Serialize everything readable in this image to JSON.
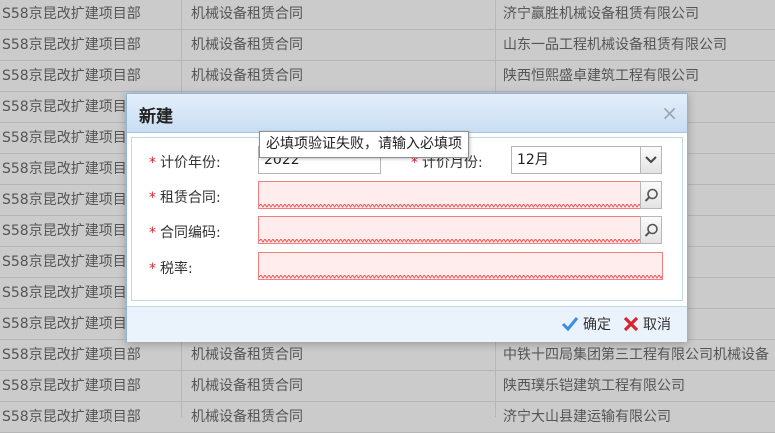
{
  "background_table": {
    "rows": [
      {
        "project": "S58京昆改扩建项目部",
        "type": "机械设备租赁合同",
        "company": "济宁赢胜机械设备租赁有限公司"
      },
      {
        "project": "S58京昆改扩建项目部",
        "type": "机械设备租赁合同",
        "company": "山东一品工程机械设备租赁有限公司"
      },
      {
        "project": "S58京昆改扩建项目部",
        "type": "机械设备租赁合同",
        "company": "陕西恒熙盛卓建筑工程有限公司"
      },
      {
        "project": "S58京昆改扩建项目部",
        "type": "",
        "company": "司"
      },
      {
        "project": "S58京昆改扩建项目部",
        "type": "",
        "company": ""
      },
      {
        "project": "S58京昆改扩建项目部",
        "type": "",
        "company": ""
      },
      {
        "project": "S58京昆改扩建项目部",
        "type": "",
        "company": ""
      },
      {
        "project": "S58京昆改扩建项目部",
        "type": "",
        "company": "有限公司"
      },
      {
        "project": "S58京昆改扩建项目部",
        "type": "",
        "company": "租赁有限公"
      },
      {
        "project": "S58京昆改扩建项目部",
        "type": "",
        "company": "司"
      },
      {
        "project": "S58京昆改扩建项目部",
        "type": "",
        "company": ""
      },
      {
        "project": "S58京昆改扩建项目部",
        "type": "机械设备租赁合同",
        "company": "中铁十四局集团第三工程有限公司机械设备"
      },
      {
        "project": "S58京昆改扩建项目部",
        "type": "机械设备租赁合同",
        "company": "陕西璞乐铠建筑工程有限公司"
      },
      {
        "project": "S58京昆改扩建项目部",
        "type": "机械设备租赁合同",
        "company": "济宁大山县建运输有限公司"
      }
    ]
  },
  "dialog": {
    "title": "新建",
    "close_icon": "×",
    "required_mark": "*",
    "fields": {
      "year_label": "计价年份:",
      "year_value": "2022",
      "month_label": "计价月份:",
      "month_value": "12月",
      "contract_label": "租赁合同:",
      "contract_code_label": "合同编码:",
      "tax_label": "税率:"
    },
    "tooltip": "必填项验证失败，请输入必填项",
    "buttons": {
      "confirm": "确定",
      "cancel": "取消"
    }
  },
  "colors": {
    "required": "#d9232e",
    "error_bg": "#ffecec",
    "error_border": "#f07f7f",
    "header_gradient_top": "#e3eefa",
    "header_gradient_bottom": "#c9def3",
    "confirm_icon": "#3a8ee6",
    "cancel_icon": "#d9232e"
  },
  "icons": {
    "close": "close-icon",
    "search": "search-icon",
    "dropdown": "chevron-down-icon",
    "confirm": "checkmark-icon",
    "cancel": "cross-icon"
  }
}
